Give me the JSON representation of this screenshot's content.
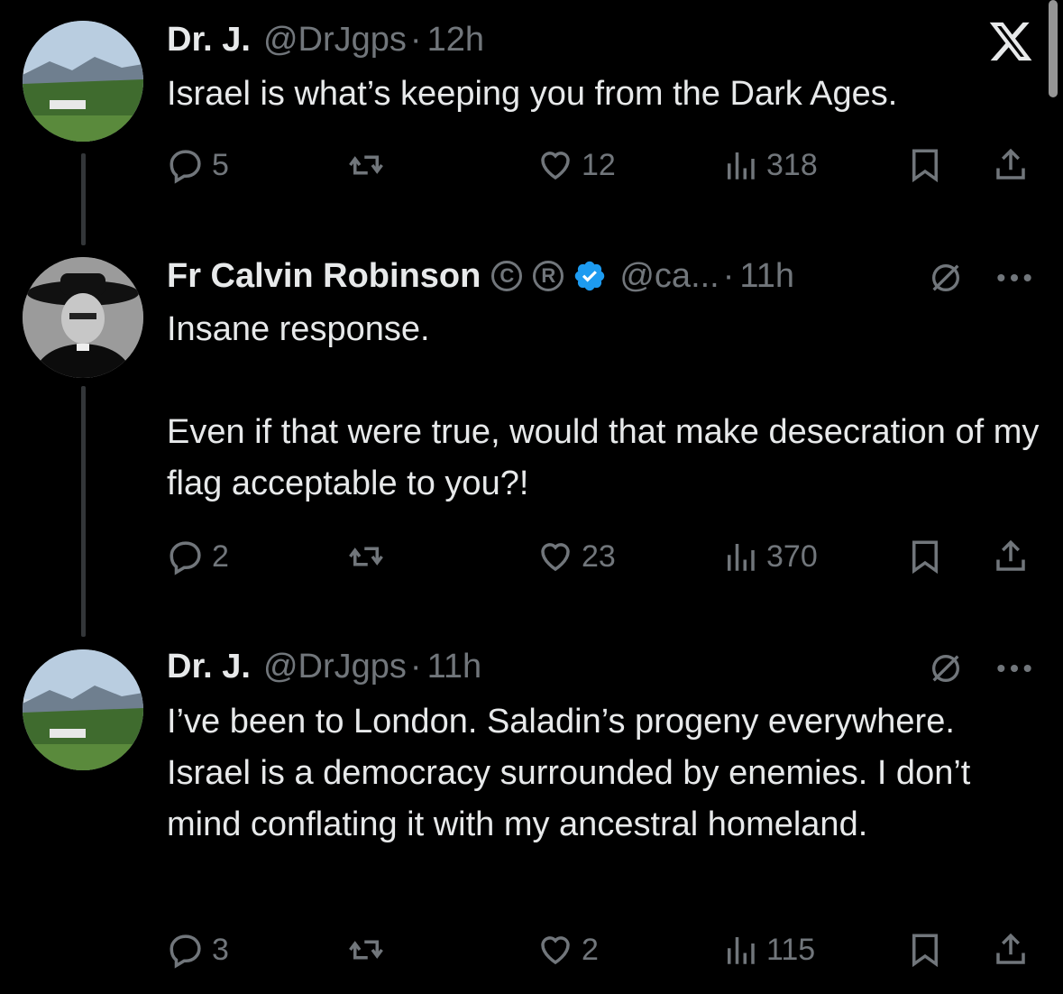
{
  "tweets": [
    {
      "name": "Dr. J.",
      "handle": "@DrJgps",
      "separator": "·",
      "time": "12h",
      "text": "Israel is what’s keeping you from the Dark Ages.",
      "replies": "5",
      "likes": "12",
      "views": "318"
    },
    {
      "name": "Fr Calvin Robinson",
      "badge_c": "C",
      "badge_r": "R",
      "handle": "@ca...",
      "separator": "·",
      "time": "11h",
      "text": "Insane response.\n\nEven if that were true, would that make desecration of my flag acceptable to you?!",
      "replies": "2",
      "likes": "23",
      "views": "370"
    },
    {
      "name": "Dr. J.",
      "handle": "@DrJgps",
      "separator": "·",
      "time": "11h",
      "text": "I’ve been to London. Saladin’s progeny everywhere. Israel is a democracy surrounded by enemies. I don’t mind conflating it with my ancestral homeland.",
      "replies": "3",
      "likes": "2",
      "views": "115"
    }
  ],
  "icons": {
    "logo": "x-logo-icon",
    "reply": "reply-icon",
    "retweet": "retweet-icon",
    "like": "heart-icon",
    "views": "views-icon",
    "bookmark": "bookmark-icon",
    "share": "share-icon",
    "grok": "grok-icon",
    "more": "more-icon",
    "verified": "verified-icon"
  },
  "colors": {
    "background": "#000000",
    "text": "#e7e9ea",
    "muted": "#71767b",
    "verified": "#1d9bf0"
  }
}
